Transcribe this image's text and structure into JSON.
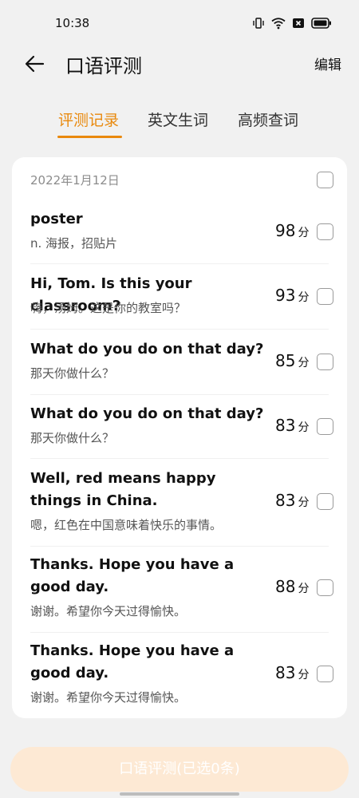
{
  "status_bar": {
    "time": "10:38",
    "icons": [
      "vibrate-icon",
      "wifi-icon",
      "sim-icon",
      "battery-icon"
    ]
  },
  "header": {
    "title": "口语评测",
    "edit_label": "编辑",
    "back_icon": "back-arrow-icon"
  },
  "tabs": [
    {
      "label": "评测记录",
      "active": true
    },
    {
      "label": "英文生词",
      "active": false
    },
    {
      "label": "高频查词",
      "active": false
    }
  ],
  "records": {
    "date": "2022年1月12日",
    "score_unit": "分",
    "items": [
      {
        "en": "poster",
        "cn": "n. 海报，招贴片",
        "score": "98"
      },
      {
        "en": "Hi, Tom. Is this your classroom?",
        "cn": "嗨，汤姆。这是你的教室吗？",
        "score": "93"
      },
      {
        "en": "What do you do on that day?",
        "cn": "那天你做什么？",
        "score": "85"
      },
      {
        "en": "What do you do on that day?",
        "cn": "那天你做什么？",
        "score": "83"
      },
      {
        "en": "Well, red means happy things in China.",
        "cn": "嗯，红色在中国意味着快乐的事情。",
        "score": "83"
      },
      {
        "en": "Thanks. Hope you have a good day.",
        "cn": "谢谢。希望你今天过得愉快。",
        "score": "88"
      },
      {
        "en": "Thanks. Hope you have a good day.",
        "cn": "谢谢。希望你今天过得愉快。",
        "score": "83"
      }
    ]
  },
  "bottom_button": {
    "label": "口语评测(已选0条)"
  },
  "colors": {
    "accent": "#e9890d",
    "button_disabled": "#fde9d4",
    "background": "#f1f1f1"
  }
}
